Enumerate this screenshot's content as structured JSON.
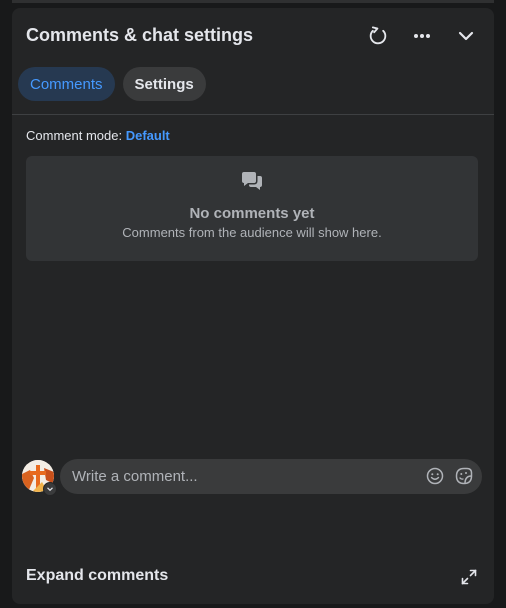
{
  "header": {
    "title": "Comments & chat settings",
    "icons": [
      "refresh-icon",
      "more-icon",
      "chevron-down-icon"
    ]
  },
  "tabs": [
    {
      "label": "Comments",
      "active": true
    },
    {
      "label": "Settings",
      "active": false
    }
  ],
  "comment_mode": {
    "label": "Comment mode: ",
    "value": "Default"
  },
  "empty_state": {
    "icon": "comments-icon",
    "title": "No comments yet",
    "subtitle": "Comments from the audience will show here."
  },
  "composer": {
    "placeholder": "Write a comment...",
    "icons": [
      "emoji-icon",
      "sticker-icon"
    ]
  },
  "footer": {
    "expand_label": "Expand comments",
    "icon": "expand-icon"
  },
  "colors": {
    "panel": "#242526",
    "accent": "#4599ff",
    "active_tab_bg": "#263951"
  }
}
